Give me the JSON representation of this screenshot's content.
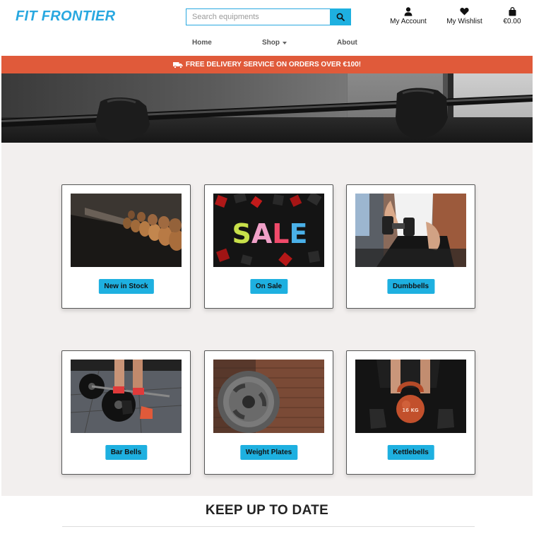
{
  "brand": {
    "name": "FIT FRONTIER"
  },
  "search": {
    "placeholder": "Search equipments",
    "value": ""
  },
  "icons": {
    "search": "search-icon",
    "account": "user-icon",
    "wishlist": "heart-icon",
    "bag": "shopping-bag-icon",
    "truck": "truck-icon"
  },
  "utility": {
    "account_label": "My Account",
    "wishlist_label": "My Wishlist",
    "bag_total": "€0.00"
  },
  "nav": {
    "home": "Home",
    "shop": "Shop",
    "about": "About"
  },
  "banner": {
    "text": "FREE DELIVERY SERVICE ON ORDERS OVER €100!"
  },
  "categories": [
    {
      "label": "New in Stock"
    },
    {
      "label": "On Sale",
      "image_text": "SALE"
    },
    {
      "label": "Dumbbells"
    },
    {
      "label": "Bar Bells"
    },
    {
      "label": "Weight Plates"
    },
    {
      "label": "Kettlebells",
      "image_text": "16 KG"
    }
  ],
  "section": {
    "title": "KEEP UP TO DATE"
  },
  "colors": {
    "brand": "#29a8e0",
    "accent": "#1eb0e0",
    "banner": "#e05a3a",
    "section_bg": "#f2efee"
  }
}
